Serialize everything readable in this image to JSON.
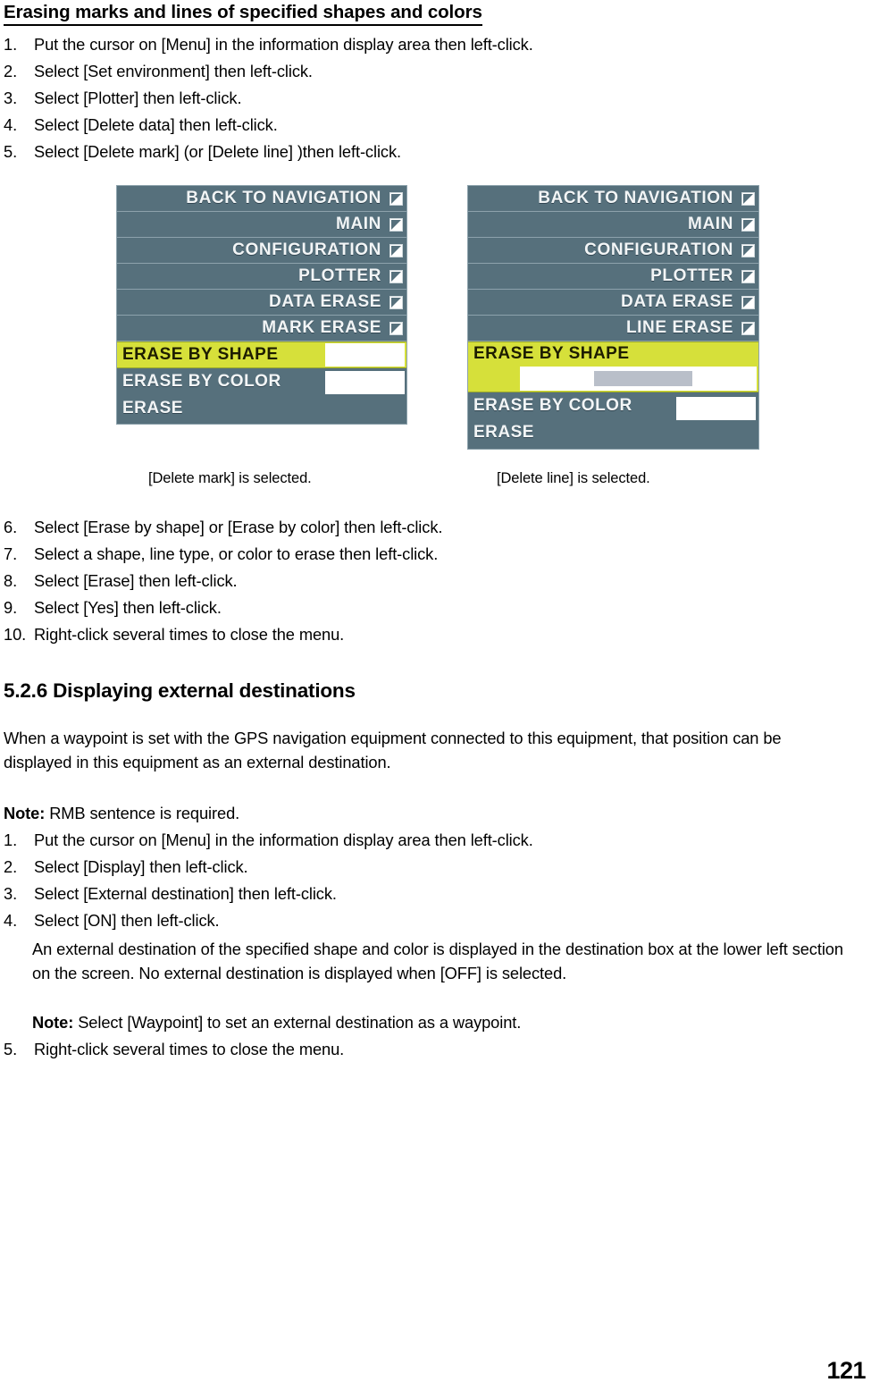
{
  "document": {
    "page_number": "121"
  },
  "section_a": {
    "heading": "Erasing marks and lines of specified shapes and colors",
    "steps_part1": [
      {
        "num": "1.",
        "text": "Put the cursor on [Menu] in the information display area then left-click."
      },
      {
        "num": "2.",
        "text": "Select [Set environment] then left-click."
      },
      {
        "num": "3.",
        "text": "Select [Plotter] then left-click."
      },
      {
        "num": "4.",
        "text": "Select [Delete data] then left-click."
      },
      {
        "num": "5.",
        "text": "Select [Delete mark] (or [Delete line] )then left-click."
      }
    ],
    "steps_part2": [
      {
        "num": "6.",
        "text": "Select [Erase by shape] or [Erase by color] then left-click."
      },
      {
        "num": "7.",
        "text": "Select a shape, line type, or color to erase then left-click."
      },
      {
        "num": "8.",
        "text": "Select [Erase] then left-click."
      },
      {
        "num": "9.",
        "text": "Select [Yes] then left-click."
      },
      {
        "num": "10.",
        "text": "Right-click several times to close the menu."
      }
    ]
  },
  "figure": {
    "caption_left": "[Delete mark] is selected.",
    "caption_right": "[Delete line] is selected.",
    "colors": {
      "menu_background": "#56707c",
      "menu_border": "#8ea3ad",
      "row_divider": "#8da2ac",
      "label_text": "#f2f5f6",
      "highlight_row": "#d6e03a",
      "highlight_border": "#9aa82b",
      "highlight_text": "#1d1d00",
      "value_box": "#ffffff",
      "fill_bar": "#b9bfc9"
    },
    "menu_left": {
      "nav_rows": [
        {
          "label": "BACK TO NAVIGATION",
          "icon": "submenu-arrow-icon"
        },
        {
          "label": "MAIN",
          "icon": "submenu-arrow-icon"
        },
        {
          "label": "CONFIGURATION",
          "icon": "submenu-arrow-icon"
        },
        {
          "label": "PLOTTER",
          "icon": "submenu-arrow-icon"
        },
        {
          "label": "DATA ERASE",
          "icon": "submenu-arrow-icon"
        },
        {
          "label": "MARK ERASE",
          "icon": "submenu-arrow-icon"
        }
      ],
      "setting_rows": [
        {
          "label": "ERASE BY SHAPE",
          "selected": true,
          "has_value_box": true,
          "value": ""
        },
        {
          "label": "ERASE BY COLOR",
          "selected": false,
          "has_value_box": true,
          "value": ""
        },
        {
          "label": "ERASE",
          "selected": false,
          "has_value_box": false,
          "value": ""
        }
      ]
    },
    "menu_right": {
      "nav_rows": [
        {
          "label": "BACK TO NAVIGATION",
          "icon": "submenu-arrow-icon"
        },
        {
          "label": "MAIN",
          "icon": "submenu-arrow-icon"
        },
        {
          "label": "CONFIGURATION",
          "icon": "submenu-arrow-icon"
        },
        {
          "label": "PLOTTER",
          "icon": "submenu-arrow-icon"
        },
        {
          "label": "DATA ERASE",
          "icon": "submenu-arrow-icon"
        },
        {
          "label": "LINE ERASE",
          "icon": "submenu-arrow-icon"
        }
      ],
      "setting_rows": [
        {
          "label": "ERASE BY SHAPE",
          "selected": true,
          "has_value_box": true,
          "value": ""
        },
        {
          "label": "ERASE BY COLOR",
          "selected": false,
          "has_value_box": true,
          "value": ""
        },
        {
          "label": "ERASE",
          "selected": false,
          "has_value_box": false,
          "value": ""
        }
      ]
    }
  },
  "section_b": {
    "heading": "5.2.6 Displaying external destinations",
    "intro": "When a waypoint is set with the GPS navigation equipment connected to this equipment, that position can be displayed in this equipment as an external destination.",
    "note_label": "Note:",
    "note_text": " RMB sentence is required.",
    "steps": [
      {
        "num": "1.",
        "text": "Put the cursor on [Menu] in the information display area then left-click."
      },
      {
        "num": "2.",
        "text": "Select [Display] then left-click."
      },
      {
        "num": "3.",
        "text": "Select [External destination] then left-click."
      },
      {
        "num": "4.",
        "text": "Select [ON] then left-click."
      }
    ],
    "step4_detail": "An external destination of the specified shape and color is displayed in the destination box at the lower left section on the screen. No external destination is displayed when [OFF] is selected.",
    "step4_note_label": "Note:",
    "step4_note_text": " Select [Waypoint] to set an external destination as a waypoint.",
    "step5": {
      "num": "5.",
      "text": "Right-click several times to close the menu."
    }
  }
}
